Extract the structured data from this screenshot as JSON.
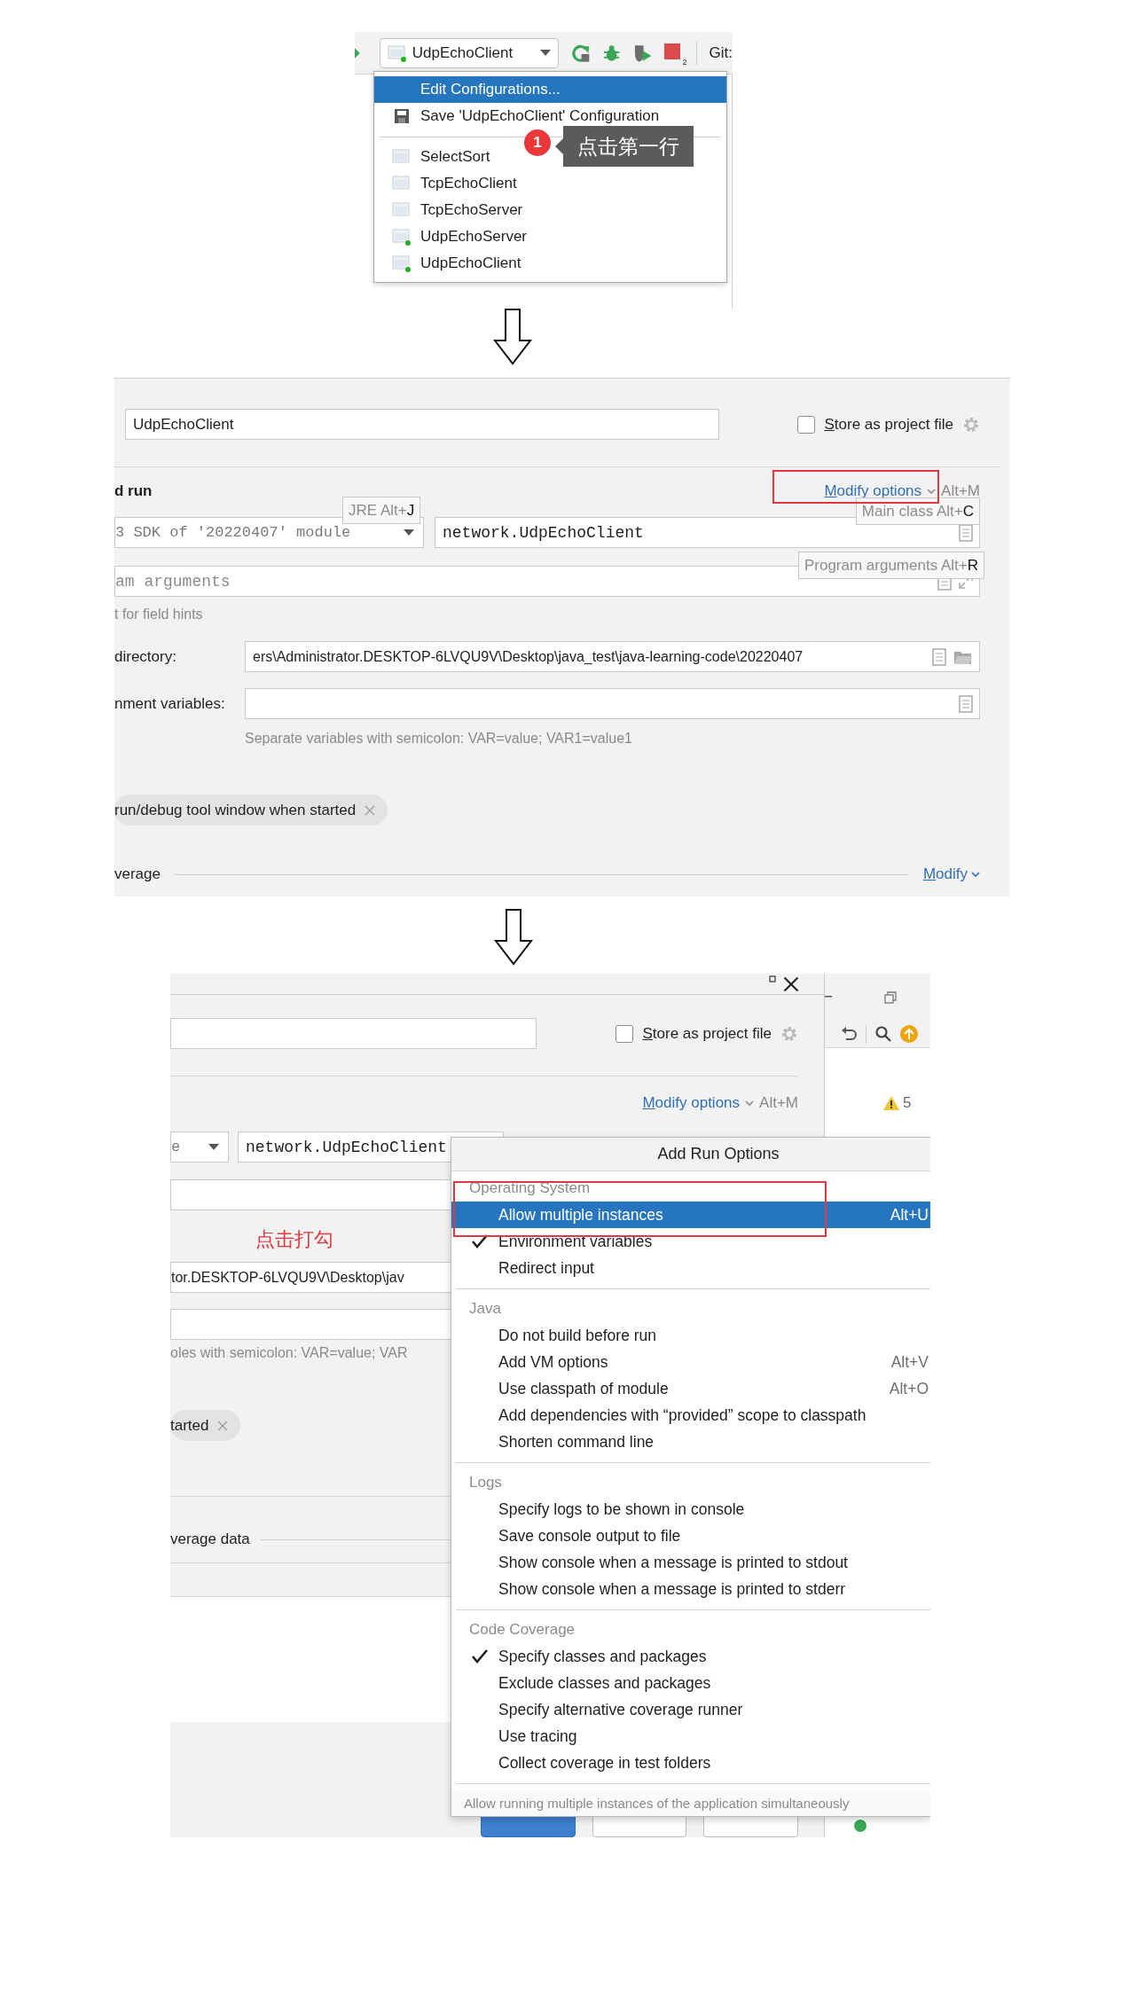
{
  "step1": {
    "toolbar": {
      "configuration": "UdpEchoClient",
      "stop_count": "2",
      "vcs_label": "Git:"
    },
    "menu": {
      "actions": [
        {
          "label": "Edit Configurations...",
          "kind": "edit",
          "selected": true
        },
        {
          "label": "Save 'UdpEchoClient' Configuration",
          "kind": "save",
          "selected": false
        }
      ],
      "configurations": [
        {
          "label": "SelectSort",
          "running": false,
          "selected": false
        },
        {
          "label": "TcpEchoClient",
          "running": false,
          "selected": false
        },
        {
          "label": "TcpEchoServer",
          "running": false,
          "selected": false
        },
        {
          "label": "UdpEchoServer",
          "running": true,
          "selected": false
        },
        {
          "label": "UdpEchoClient",
          "running": true,
          "selected": false
        }
      ]
    },
    "callout": {
      "number": "1",
      "text": "点击第一行"
    }
  },
  "step2": {
    "name": "UdpEchoClient",
    "store_as_project_file": {
      "label": "Store as project file",
      "checked": false
    },
    "section_title": "d run",
    "modify_options": {
      "label": "Modify options",
      "shortcut": "Alt+M"
    },
    "jre": "3 SDK of '20220407' module",
    "main_class": "network.UdpEchoClient",
    "program_arguments": {
      "placeholder": "am arguments"
    },
    "field_hints": "t for field hints",
    "working_directory": {
      "label": "directory:",
      "value": "ers\\Administrator.DESKTOP-6LVQU9V\\Desktop\\java_test\\java-learning-code\\20220407"
    },
    "environment_variables": {
      "label": "nment variables:",
      "hint": "Separate variables with semicolon: VAR=value; VAR1=value1"
    },
    "chips": [
      {
        "label": "run/debug tool window when started"
      }
    ],
    "coverage": {
      "label": "verage",
      "link": "Modify"
    },
    "tooltips": [
      {
        "label": "JRE Alt+",
        "key": "J"
      },
      {
        "label": "Main class Alt+",
        "key": "C"
      },
      {
        "label": "Program arguments Alt+",
        "key": "R"
      }
    ]
  },
  "step3": {
    "store_as_project_file": {
      "label": "Store as project file",
      "checked": false
    },
    "modify_options": {
      "label": "Modify options",
      "shortcut": "Alt+M"
    },
    "jre": "e",
    "main_class": "network.UdpEchoClient",
    "working_directory": "tor.DESKTOP-6LVQU9V\\Desktop\\jav",
    "env_hint": "oles with semicolon: VAR=value; VAR",
    "chips": [
      {
        "label": "tarted"
      }
    ],
    "coverage": {
      "label": "verage data"
    },
    "annotation": "点击打勾",
    "ide": {
      "warnings": "5"
    },
    "popup": {
      "title": "Add Run Options",
      "groups": [
        {
          "title": "Operating System",
          "items": [
            {
              "label": "Allow multiple instances",
              "shortcut": "Alt+U",
              "checked": false,
              "selected": true
            },
            {
              "label": "Environment variables",
              "checked": true,
              "selected": false
            },
            {
              "label": "Redirect input",
              "checked": false,
              "selected": false
            }
          ]
        },
        {
          "title": "Java",
          "items": [
            {
              "label": "Do not build before run",
              "checked": false,
              "selected": false
            },
            {
              "label": "Add VM options",
              "shortcut": "Alt+V",
              "checked": false,
              "selected": false
            },
            {
              "label": "Use classpath of module",
              "shortcut": "Alt+O",
              "checked": false,
              "selected": false
            },
            {
              "label": "Add dependencies with “provided” scope to classpath",
              "checked": false,
              "selected": false
            },
            {
              "label": "Shorten command line",
              "checked": false,
              "selected": false
            }
          ]
        },
        {
          "title": "Logs",
          "items": [
            {
              "label": "Specify logs to be shown in console",
              "checked": false,
              "selected": false
            },
            {
              "label": "Save console output to file",
              "checked": false,
              "selected": false
            },
            {
              "label": "Show console when a message is printed to stdout",
              "checked": false,
              "selected": false
            },
            {
              "label": "Show console when a message is printed to stderr",
              "checked": false,
              "selected": false
            }
          ]
        },
        {
          "title": "Code Coverage",
          "items": [
            {
              "label": "Specify classes and packages",
              "checked": true,
              "selected": false
            },
            {
              "label": "Exclude classes and packages",
              "checked": false,
              "selected": false
            },
            {
              "label": "Specify alternative coverage runner",
              "checked": false,
              "selected": false
            },
            {
              "label": "Use tracing",
              "checked": false,
              "selected": false
            },
            {
              "label": "Collect coverage in test folders",
              "checked": false,
              "selected": false
            }
          ]
        }
      ],
      "footer": "Allow running multiple instances of the application simultaneously"
    }
  }
}
